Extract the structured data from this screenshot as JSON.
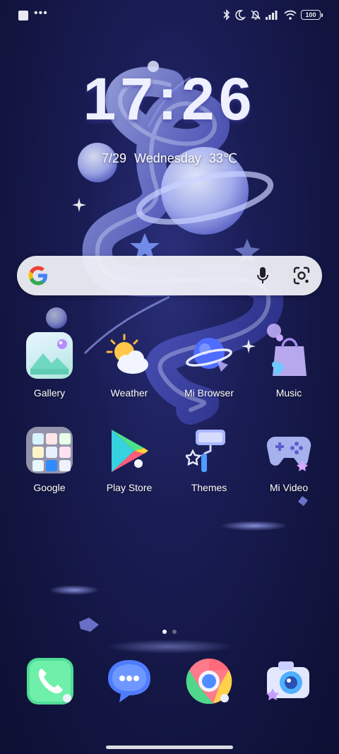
{
  "status_bar": {
    "battery_level": "100",
    "icons": [
      "notification-square-icon",
      "more-dots-icon",
      "bluetooth-icon",
      "dnd-moon-icon",
      "mute-bell-icon",
      "signal-icon",
      "wifi-icon",
      "battery-icon"
    ]
  },
  "clock": {
    "time": "17:26",
    "date": "7/29",
    "weekday": "Wednesday",
    "temperature": "33℃"
  },
  "search": {
    "logo": "google-logo",
    "icons": [
      "mic-icon",
      "lens-icon"
    ]
  },
  "apps": [
    {
      "label": "Gallery",
      "icon": "gallery-icon"
    },
    {
      "label": "Weather",
      "icon": "weather-icon"
    },
    {
      "label": "Mi Browser",
      "icon": "browser-icon"
    },
    {
      "label": "Music",
      "icon": "music-icon"
    },
    {
      "label": "Google",
      "icon": "google-folder-icon"
    },
    {
      "label": "Play Store",
      "icon": "play-store-icon"
    },
    {
      "label": "Themes",
      "icon": "themes-icon"
    },
    {
      "label": "Mi Video",
      "icon": "video-icon"
    }
  ],
  "pages": {
    "count": 2,
    "current": 1
  },
  "dock": [
    {
      "icon": "phone-icon"
    },
    {
      "icon": "messages-icon"
    },
    {
      "icon": "chrome-icon"
    },
    {
      "icon": "camera-icon"
    }
  ],
  "colors": {
    "background": "#151848",
    "accent": "#7f8cff"
  }
}
